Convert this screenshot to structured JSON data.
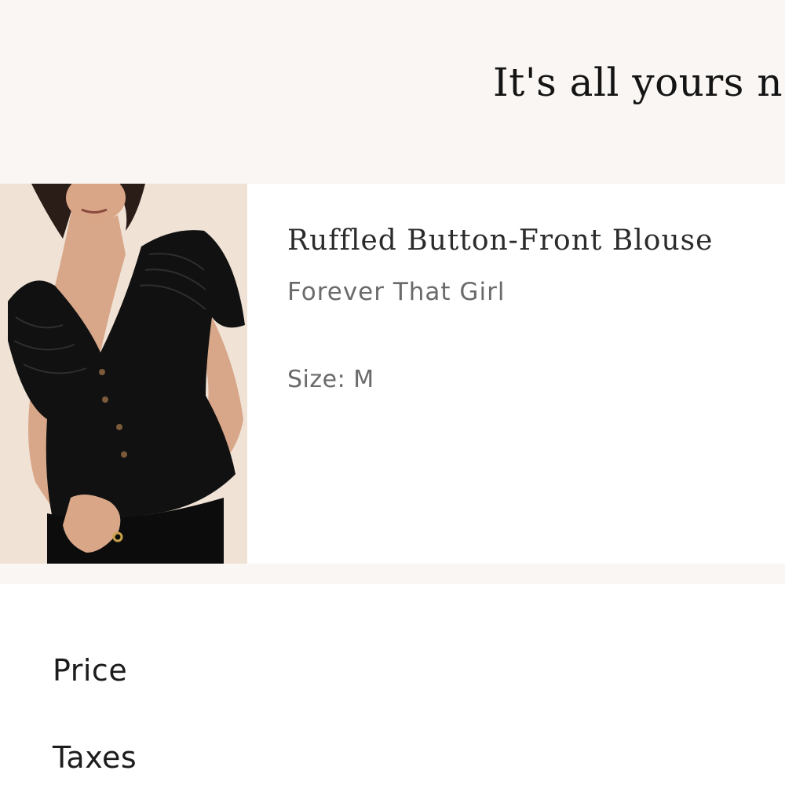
{
  "header": {
    "headline": "It's all yours n"
  },
  "product": {
    "title": "Ruffled Button-Front Blouse",
    "brand": "Forever That Girl",
    "size_text": "Size: M",
    "image_alt": "Model wearing black ruffled button-front blouse"
  },
  "summary": {
    "price_label": "Price",
    "taxes_label": "Taxes"
  },
  "colors": {
    "banner_background": "#faf6f3",
    "card_background": "#ffffff",
    "title_text": "#2b2b2b",
    "secondary_text": "#6a6a6a",
    "garment": "#111111",
    "skin": "#d9a788"
  }
}
